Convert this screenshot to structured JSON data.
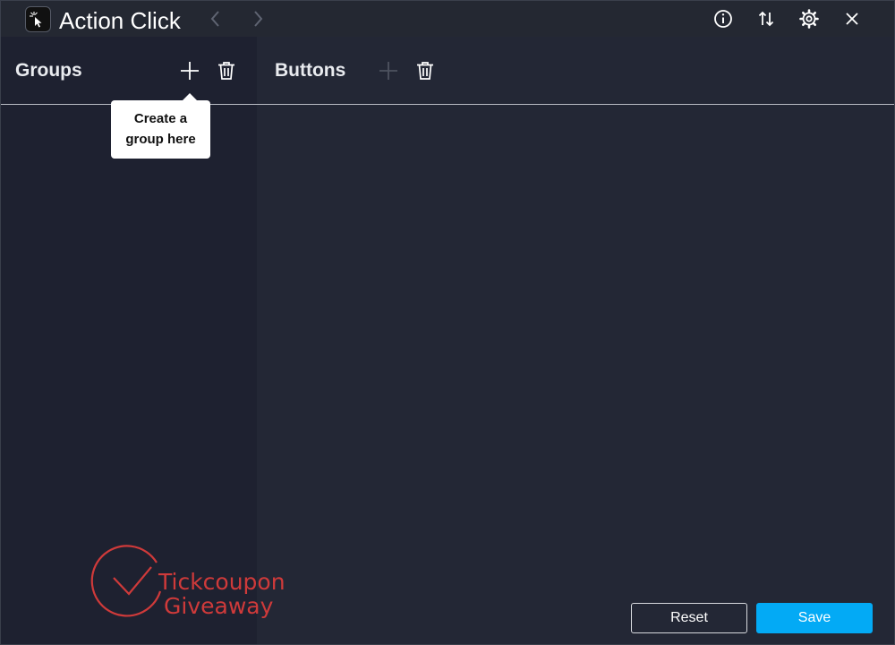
{
  "app": {
    "title": "Action Click",
    "icon": "cursor-click-icon"
  },
  "titlebar": {
    "back_icon": "chevron-left-icon",
    "forward_icon": "chevron-right-icon",
    "info_icon": "info-icon",
    "sort_icon": "sort-arrows-icon",
    "settings_icon": "gear-icon",
    "close_icon": "close-icon"
  },
  "groups": {
    "title": "Groups",
    "add_icon": "plus-icon",
    "delete_icon": "trash-icon",
    "tooltip": {
      "line1": "Create a",
      "line2": "group here"
    }
  },
  "buttons": {
    "title": "Buttons",
    "add_icon": "plus-icon",
    "delete_icon": "trash-icon"
  },
  "footer": {
    "reset_label": "Reset",
    "save_label": "Save"
  },
  "watermark": {
    "line1": "Tickcoupon",
    "line2": "Giveaway"
  },
  "colors": {
    "background": "#232735",
    "left_pane": "#1e2130",
    "accent": "#03aaf5",
    "watermark": "#cf3a3a"
  }
}
